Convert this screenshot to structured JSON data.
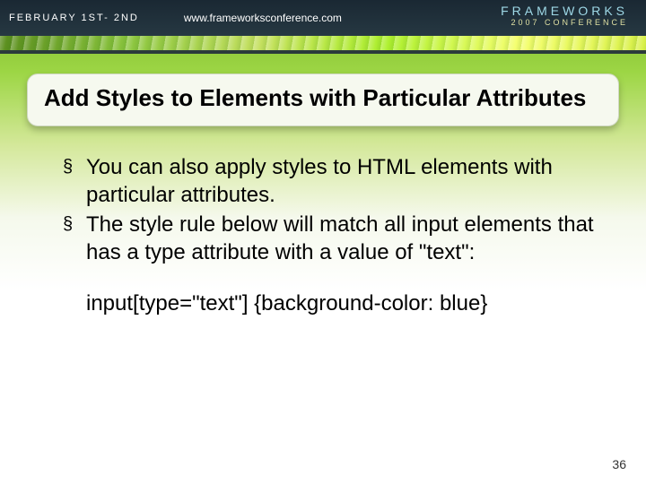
{
  "topbar": {
    "date": "FEBRUARY 1ST- 2ND",
    "url": "www.frameworksconference.com",
    "logo_main": "FRAMEWORKS",
    "logo_sub": "2007 CONFERENCE"
  },
  "title": "Add Styles to Elements with Particular Attributes",
  "bullets": [
    "You can also apply styles to HTML elements with particular attributes.",
    "The style rule below will match all input elements that has a type attribute with a value of \"text\":"
  ],
  "code": "input[type=\"text\"] {background-color: blue}",
  "page_number": "36"
}
